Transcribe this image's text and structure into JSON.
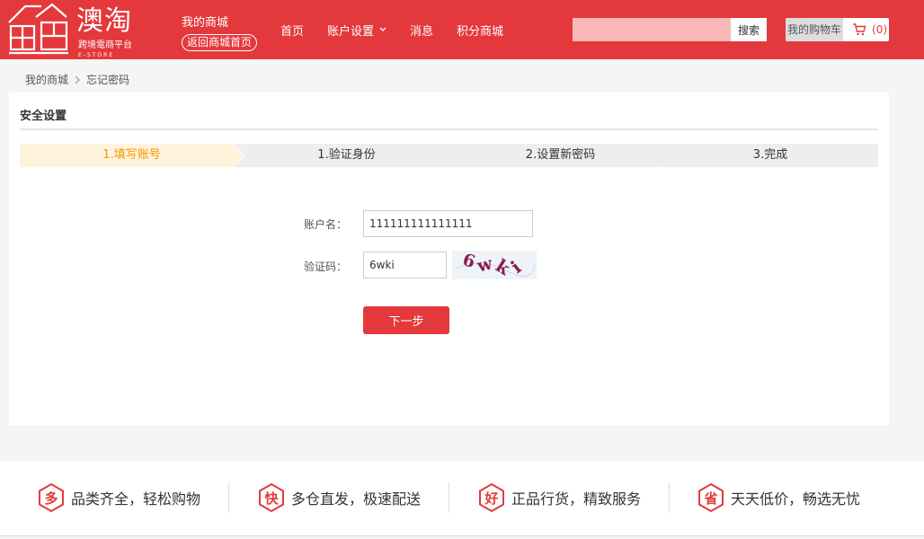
{
  "header": {
    "logo": {
      "name": "澳淘",
      "sub": "跨境電商平台",
      "tiny": "E-STORE"
    },
    "mall_title": "我的商城",
    "mall_back": "返回商城首页",
    "nav": [
      "首页",
      "账户设置",
      "消息",
      "积分商城"
    ],
    "search": {
      "value": "",
      "placeholder": "",
      "button": "搜索"
    },
    "cart": {
      "label": "我的购物车",
      "count": "(0)"
    }
  },
  "breadcrumb": {
    "home": "我的商城",
    "current": "忘记密码"
  },
  "panel": {
    "title": "安全设置",
    "steps": [
      "1.填写账号",
      "1.验证身份",
      "2.设置新密码",
      "3.完成"
    ],
    "form": {
      "account_label": "账户名：",
      "account_value": "111111111111111",
      "captcha_label": "验证码：",
      "captcha_value": "6wki",
      "captcha_image_text": "6wki",
      "next_button": "下一步"
    }
  },
  "footer": {
    "features": [
      {
        "badge": "多",
        "text": "品类齐全，轻松购物"
      },
      {
        "badge": "快",
        "text": "多仓直发，极速配送"
      },
      {
        "badge": "好",
        "text": "正品行货，精致服务"
      },
      {
        "badge": "省",
        "text": "天天低价，畅选无忧"
      }
    ]
  },
  "colors": {
    "brand": "#e4393c",
    "active_step": "#f39800",
    "active_step_bg": "#fff3dc"
  },
  "icons": [
    "logo-mark-icon",
    "chevron-down-icon",
    "cart-icon",
    "chevron-right-icon",
    "hexagon-badge-icon"
  ]
}
